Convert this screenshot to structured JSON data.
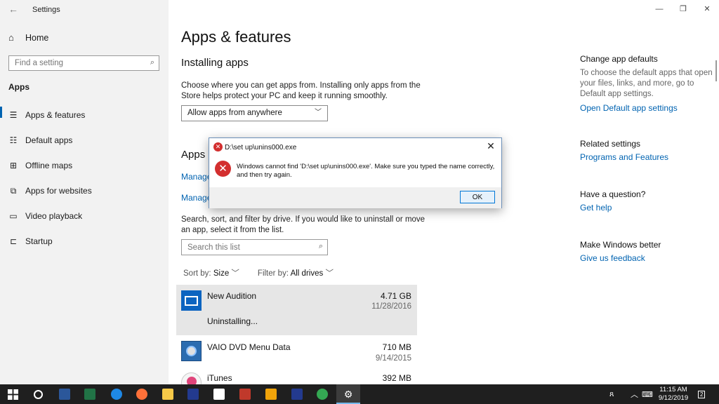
{
  "window": {
    "title": "Settings"
  },
  "sidebar": {
    "home": "Home",
    "search_placeholder": "Find a setting",
    "section": "Apps",
    "items": [
      {
        "label": "Apps & features",
        "icon": "list-icon",
        "glyph": "☰"
      },
      {
        "label": "Default apps",
        "icon": "default-apps-icon",
        "glyph": "☷"
      },
      {
        "label": "Offline maps",
        "icon": "map-icon",
        "glyph": "⊞"
      },
      {
        "label": "Apps for websites",
        "icon": "web-apps-icon",
        "glyph": "⧉"
      },
      {
        "label": "Video playback",
        "icon": "video-icon",
        "glyph": "▭"
      },
      {
        "label": "Startup",
        "icon": "startup-icon",
        "glyph": "⊏"
      }
    ]
  },
  "main": {
    "title": "Apps & features",
    "installing": {
      "heading": "Installing apps",
      "text": "Choose where you can get apps from. Installing only apps from the Store helps protect your PC and keep it running smoothly.",
      "dropdown_value": "Allow apps from anywhere"
    },
    "apps_section": {
      "heading": "Apps",
      "link1": "Manage",
      "link2": "Manage",
      "text": "Search, sort, and filter by drive. If you would like to uninstall or move an app, select it from the list.",
      "search_placeholder": "Search this list",
      "sort_label": "Sort by:",
      "sort_value": "Size",
      "filter_label": "Filter by:",
      "filter_value": "All drives"
    },
    "apps": [
      {
        "name": "New Audition",
        "size": "4.71 GB",
        "date": "11/28/2016",
        "status": "Uninstalling..."
      },
      {
        "name": "VAIO DVD Menu Data",
        "size": "710 MB",
        "date": "9/14/2015"
      },
      {
        "name": "iTunes",
        "size": "392 MB"
      }
    ]
  },
  "right_panel": {
    "change_defaults": {
      "heading": "Change app defaults",
      "text": "To choose the default apps that open your files, links, and more, go to Default app settings.",
      "link": "Open Default app settings"
    },
    "related": {
      "heading": "Related settings",
      "link": "Programs and Features"
    },
    "question": {
      "heading": "Have a question?",
      "link": "Get help"
    },
    "better": {
      "heading": "Make Windows better",
      "link": "Give us feedback"
    }
  },
  "dialog": {
    "title": "D:\\set up\\unins000.exe",
    "message": "Windows cannot find 'D:\\set up\\unins000.exe'. Make sure you typed the name correctly, and then try again.",
    "ok": "OK"
  },
  "taskbar": {
    "time": "11:15 AM",
    "date": "9/12/2019",
    "notification_count": "2"
  },
  "colors": {
    "accent": "#0063b1",
    "sidebar_bg": "#f2f2f2",
    "error_red": "#d32f2f",
    "taskbar_bg": "#1f1f1f"
  }
}
